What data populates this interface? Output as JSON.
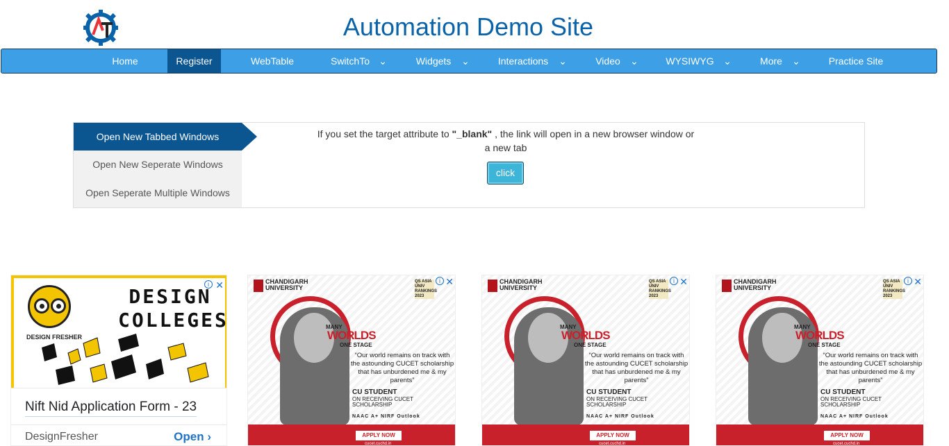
{
  "header": {
    "title": "Automation Demo Site",
    "logo_icon": "gear-logo-icon",
    "logo_letters": "AT"
  },
  "nav": {
    "items": [
      {
        "label": "Home",
        "has_dropdown": false
      },
      {
        "label": "Register",
        "has_dropdown": false,
        "active": true
      },
      {
        "label": "WebTable",
        "has_dropdown": false
      },
      {
        "label": "SwitchTo",
        "has_dropdown": true
      },
      {
        "label": "Widgets",
        "has_dropdown": true
      },
      {
        "label": "Interactions",
        "has_dropdown": true
      },
      {
        "label": "Video",
        "has_dropdown": true
      },
      {
        "label": "WYSIWYG",
        "has_dropdown": true
      },
      {
        "label": "More",
        "has_dropdown": true
      },
      {
        "label": "Practice Site",
        "has_dropdown": false
      }
    ],
    "chevron_icon": "chevron-down-icon"
  },
  "windows": {
    "tabs": [
      {
        "label": "Open New Tabbed Windows",
        "active": true
      },
      {
        "label": "Open New Seperate Windows"
      },
      {
        "label": "Open Seperate Multiple Windows"
      }
    ],
    "description_pre": "If you set the target attribute to ",
    "description_code": "\"_blank\"",
    "description_post": " , the link will open in a new browser window or a new tab",
    "button_label": "click"
  },
  "ads": {
    "ad1": {
      "brand": "DESIGN FRESHER",
      "headline": "DESIGN COLLEGES",
      "title": "Nift Nid Application Form - 23",
      "advertiser": "DesignFresher",
      "cta": "Open"
    },
    "cu": {
      "university": "CHANDIGARH UNIVERSITY",
      "ranking": "QS ASIA UNIV RANKINGS 2023",
      "many": "MANY",
      "worlds": "WORLDS",
      "one_stage": "ONE STAGE",
      "quote": "“Our world remains on track with the astounding CUCET scholarship that has unburdened me & my parents”",
      "student": "CU STUDENT",
      "receiving": "ON RECEIVING CUCET SCHOLARSHIP",
      "accreditations": "NAAC A+   NIRF   Outlook",
      "apply": "APPLY NOW",
      "url": "cucet.cuchd.in"
    }
  },
  "colors": {
    "brand_blue": "#0a63a8",
    "nav_bg": "#3da0e6",
    "nav_active": "#0b5591",
    "button_bg": "#3db5d9",
    "cu_red": "#c9212b",
    "ad_yellow": "#f3c400"
  }
}
